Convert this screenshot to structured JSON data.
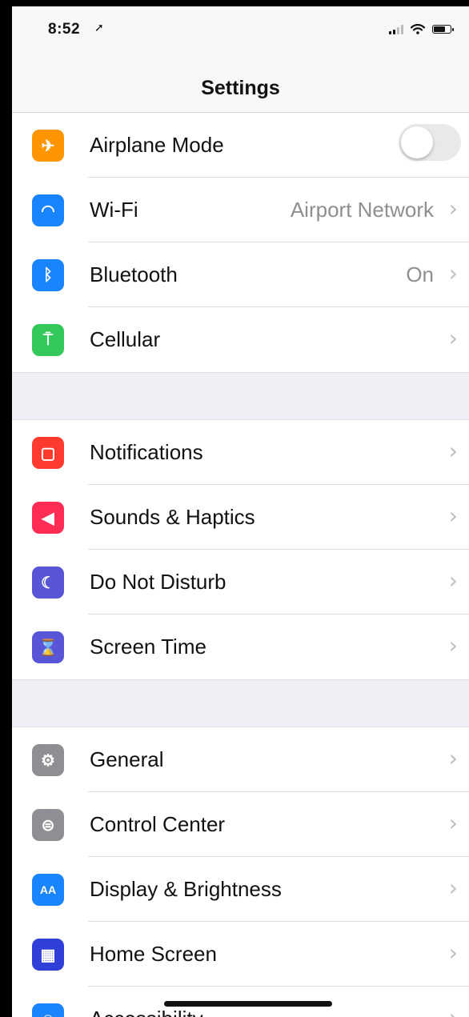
{
  "status_bar": {
    "time": "8:52",
    "location_icon": "location-arrow-icon"
  },
  "nav": {
    "title": "Settings"
  },
  "groups": [
    [
      {
        "name": "airplane-mode",
        "label": "Airplane Mode",
        "icon": "airplane-icon",
        "color": "#ff9500",
        "glyph": "✈",
        "toggle": false
      },
      {
        "name": "wifi",
        "label": "Wi-Fi",
        "detail": "Airport Network",
        "icon": "wifi-icon",
        "color": "#1a84ff",
        "glyph": "◠"
      },
      {
        "name": "bluetooth",
        "label": "Bluetooth",
        "detail": "On",
        "icon": "bluetooth-icon",
        "color": "#1a84ff",
        "glyph": "ᛒ"
      },
      {
        "name": "cellular",
        "label": "Cellular",
        "icon": "antenna-icon",
        "color": "#34c759",
        "glyph": "⍑"
      }
    ],
    [
      {
        "name": "notifications",
        "label": "Notifications",
        "icon": "notification-icon",
        "color": "#ff3b30",
        "glyph": "▢"
      },
      {
        "name": "sounds-haptics",
        "label": "Sounds & Haptics",
        "icon": "speaker-icon",
        "color": "#ff2d55",
        "glyph": "◀"
      },
      {
        "name": "do-not-disturb",
        "label": "Do Not Disturb",
        "icon": "moon-icon",
        "color": "#5856d6",
        "glyph": "☾"
      },
      {
        "name": "screen-time",
        "label": "Screen Time",
        "icon": "hourglass-icon",
        "color": "#5856d6",
        "glyph": "⌛"
      }
    ],
    [
      {
        "name": "general",
        "label": "General",
        "icon": "gear-icon",
        "color": "#8e8e93",
        "glyph": "⚙"
      },
      {
        "name": "control-center",
        "label": "Control Center",
        "icon": "switches-icon",
        "color": "#8e8e93",
        "glyph": "⊜"
      },
      {
        "name": "display-brightness",
        "label": "Display & Brightness",
        "icon": "text-size-icon",
        "color": "#1a84ff",
        "glyph": "AA"
      },
      {
        "name": "home-screen",
        "label": "Home Screen",
        "icon": "app-grid-icon",
        "color": "#2f3fd8",
        "glyph": "▦"
      },
      {
        "name": "accessibility",
        "label": "Accessibility",
        "icon": "accessibility-icon",
        "color": "#1a84ff",
        "glyph": "☺"
      }
    ]
  ]
}
